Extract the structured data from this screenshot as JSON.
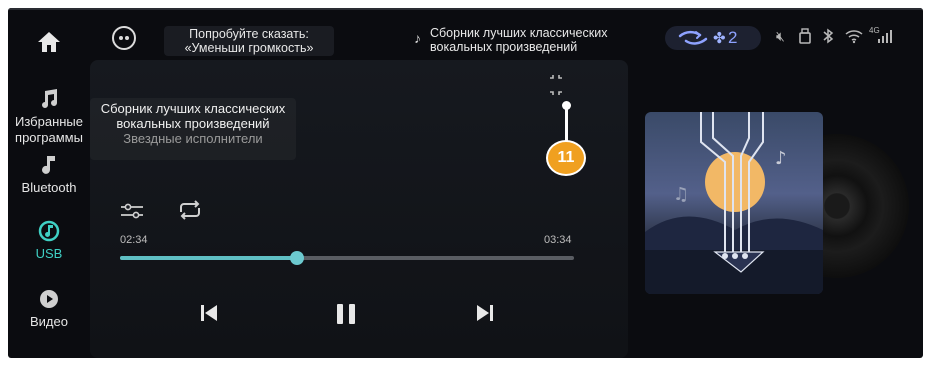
{
  "sidebar": {
    "items": [
      {
        "label": "",
        "icon": "home-icon"
      },
      {
        "label": "Избранные программы",
        "icon": "music-notes-icon"
      },
      {
        "label": "Bluetooth",
        "icon": "bluetooth-music-icon"
      },
      {
        "label": "USB",
        "icon": "usb-music-icon",
        "active": true
      },
      {
        "label": "Видео",
        "icon": "play-icon"
      }
    ]
  },
  "topbar": {
    "voice_hint": "Попробуйте сказать: «Уменьши громкость»",
    "now_playing": "Сборник лучших классических вокальных произведений",
    "fan_level": "2"
  },
  "player": {
    "title": "Сборник лучших классических вокальных произведений",
    "artist": "Звездные исполнители",
    "current_time": "02:34",
    "total_time": "03:34",
    "progress": 0.39,
    "annotation_badge": "11"
  },
  "colors": {
    "accent": "#3fd0c4",
    "progress": "#5fbfc4",
    "badge": "#f0a020",
    "fan": "#8ea2ff"
  }
}
